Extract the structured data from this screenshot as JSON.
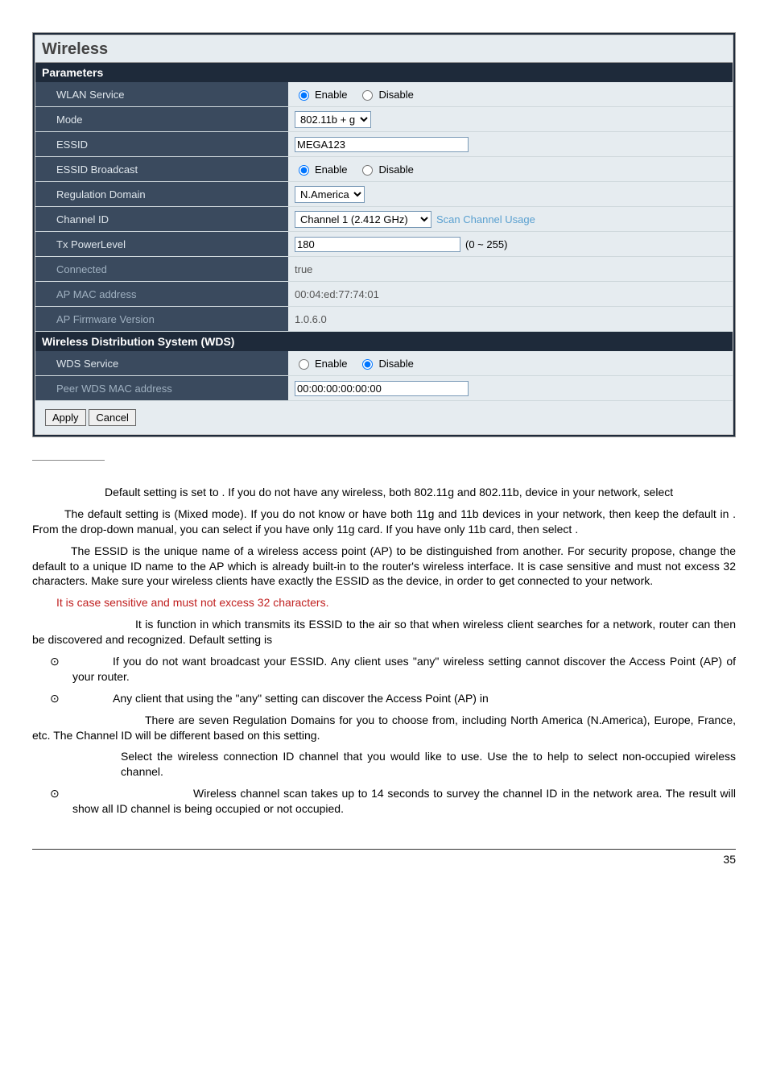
{
  "panel": {
    "title": "Wireless",
    "section_params": "Parameters",
    "wlan_service_label": "WLAN Service",
    "enable_label": "Enable",
    "disable_label": "Disable",
    "mode_label": "Mode",
    "mode_value": "802.11b + g",
    "essid_label": "ESSID",
    "essid_value": "MEGA123",
    "essid_broadcast_label": "ESSID Broadcast",
    "regulation_domain_label": "Regulation Domain",
    "regulation_value": "N.America",
    "channel_id_label": "Channel ID",
    "channel_value": "Channel 1 (2.412 GHz)",
    "scan_link": "Scan Channel Usage",
    "tx_power_label": "Tx PowerLevel",
    "tx_value": "180",
    "tx_hint": "(0 ~ 255)",
    "connected_label": "Connected",
    "connected_value": "true",
    "ap_mac_label": "AP MAC address",
    "ap_mac_value": "00:04:ed:77:74:01",
    "ap_fw_label": "AP Firmware Version",
    "ap_fw_value": "1.0.6.0",
    "section_wds": "Wireless Distribution System (WDS)",
    "wds_service_label": "WDS Service",
    "peer_mac_label": "Peer WDS MAC address",
    "peer_mac_value": "00:00:00:00:00:00",
    "apply": "Apply",
    "cancel": "Cancel"
  },
  "doc": {
    "p1": "Default setting is set to           .  If you do not have any wireless, both 802.11g and 802.11b, device in your network, select",
    "p2": "The default setting is                    (Mixed mode). If you do not know or have both 11g and 11b devices in your network, then keep the default in                       .  From the drop-down manual, you can select             if you have only 11g card.  If you have only 11b card, then select              .",
    "p3": "The ESSID is the unique name of a wireless access point (AP) to be distinguished from another. For security propose, change the default               to a unique ID name to the AP which is already built-in to the router's wireless interface. It is case sensitive and must not excess 32 characters. Make sure your wireless clients have exactly the ESSID as the device, in order to get connected to your network.",
    "pred": "It is case sensitive and must not excess 32 characters.",
    "p4": "It is function in which transmits its ESSID to the air so that when wireless client searches for a network, router can then be discovered and recognized. Default setting is",
    "li1": "If you do not want broadcast your ESSID.  Any client uses \"any\" wireless setting cannot discover the Access Point (AP) of your router.",
    "li2": "Any client that using the \"any\" setting can discover the Access Point (AP) in",
    "p5": "There are seven Regulation Domains for you to choose from, including North America (N.America), Europe, France, etc. The Channel ID will be different based on this setting.",
    "p6": "Select the wireless connection ID channel that you would like to use.  Use the                to help to select non-occupied wireless channel.",
    "li3": "Wireless channel scan takes up to 14 seconds to survey the channel ID in the network area.  The result will show all ID channel is being occupied or not occupied.",
    "pagenum": "35"
  }
}
